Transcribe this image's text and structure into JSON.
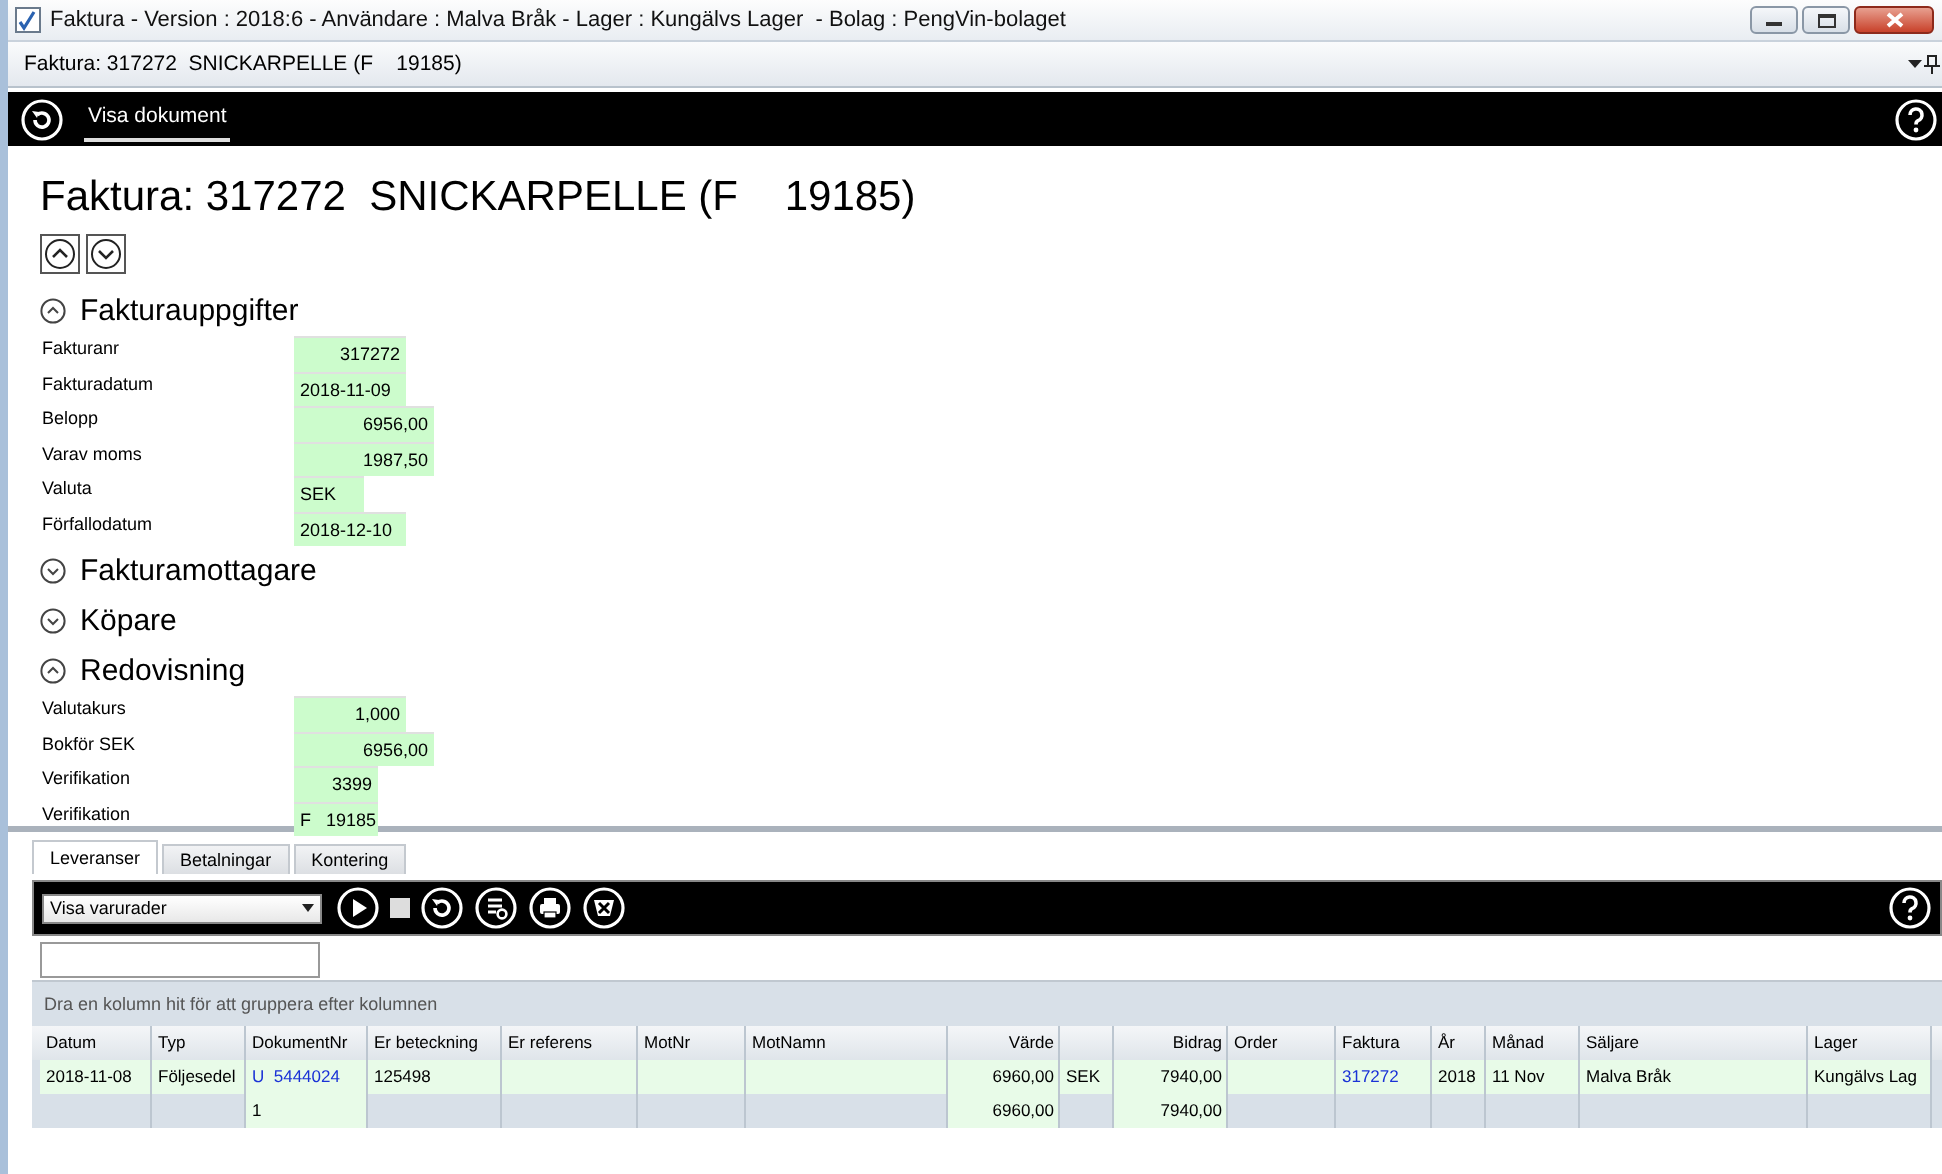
{
  "window": {
    "title": "Faktura - Version : 2018:6 - Användare : Malva Bråk - Lager : Kungälvs Lager  - Bolag : PengVin-bolaget"
  },
  "document_bar": {
    "title": "Faktura: 317272  SNICKARPELLE (F    19185)"
  },
  "toolbar": {
    "tabs": [
      {
        "label": "Visa dokument",
        "selected": true
      }
    ]
  },
  "heading": "Faktura: 317272  SNICKARPELLE (F    19185)",
  "sections": [
    {
      "title": "Fakturauppgifter",
      "expanded": true,
      "fields": [
        {
          "label": "Fakturanr",
          "value": "317272",
          "kind": "number"
        },
        {
          "label": "Fakturadatum",
          "value": "2018-11-09",
          "kind": "text"
        },
        {
          "label": "Belopp",
          "value": "6956,00",
          "kind": "number"
        },
        {
          "label": "Varav moms",
          "value": "1987,50",
          "kind": "number"
        },
        {
          "label": "Valuta",
          "value": "SEK",
          "kind": "text"
        },
        {
          "label": "Förfallodatum",
          "value": "2018-12-10",
          "kind": "text"
        }
      ]
    },
    {
      "title": "Fakturamottagare",
      "expanded": false
    },
    {
      "title": "Köpare",
      "expanded": false
    },
    {
      "title": "Redovisning",
      "expanded": true,
      "fields": [
        {
          "label": "Valutakurs",
          "value": "1,000",
          "kind": "number"
        },
        {
          "label": "Bokför SEK",
          "value": "6956,00",
          "kind": "number"
        },
        {
          "label": "Verifikation",
          "value": "3399",
          "kind": "number"
        },
        {
          "label": "Verifikation",
          "value": "F   19185",
          "kind": "text"
        }
      ]
    }
  ],
  "bottom_tabs": [
    {
      "label": "Leveranser",
      "selected": true
    },
    {
      "label": "Betalningar",
      "selected": false
    },
    {
      "label": "Kontering",
      "selected": false
    }
  ],
  "grid_toolbar": {
    "view_select": "Visa varurader"
  },
  "group_panel": "Dra en kolumn hit för att gruppera efter kolumnen",
  "table": {
    "columns": [
      "Datum",
      "Typ",
      "DokumentNr",
      "Er beteckning",
      "Er referens",
      "MotNr",
      "MotNamn",
      "Värde",
      "Bidrag",
      "Order",
      "Faktura",
      "År",
      "Månad",
      "Säljare",
      "Lager"
    ],
    "rows": [
      {
        "datum": "2018-11-08",
        "typ": "Följesedel",
        "dokument_nr": "U  5444024",
        "er_beteckning": "125498",
        "varde": "6960,00",
        "column_9": "SEK",
        "bidrag": "7940,00",
        "faktura": "317272",
        "ar": "2018",
        "manad": "11 Nov",
        "saljare": "Malva Bråk",
        "lager": "Kungälvs Lag"
      }
    ],
    "summary": {
      "dokument_nr": "1",
      "varde": "6960,00",
      "bidrag": "7940,00"
    }
  }
}
